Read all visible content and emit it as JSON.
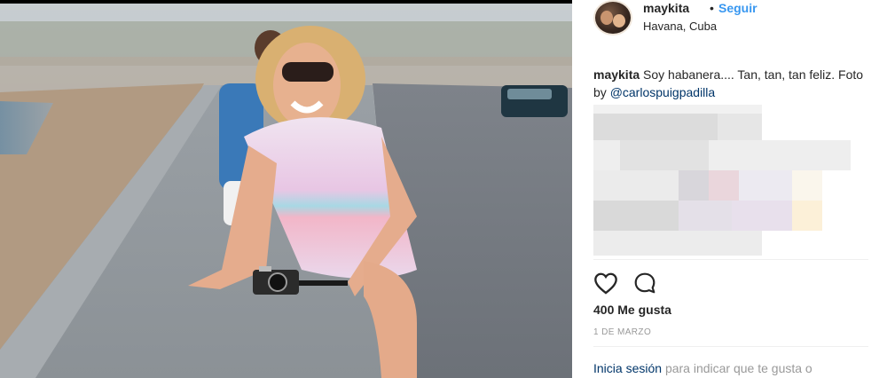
{
  "post": {
    "username": "maykita",
    "separator": "•",
    "follow_label": "Seguir",
    "location": "Havana, Cuba",
    "caption": {
      "username": "maykita",
      "text": "Soy habanera.... Tan, tan, tan feliz. Foto by ",
      "mention": "@carlospuigpadilla"
    },
    "likes": "400 Me gusta",
    "date": "1 DE MARZO",
    "login": {
      "link": "Inicia sesión",
      "rest": "para indicar que te gusta o"
    }
  },
  "icons": {
    "like": "heart-outline-icon",
    "comment": "comment-bubble-icon"
  },
  "colors": {
    "link_blue": "#3897f0",
    "mention_blue": "#003569",
    "muted": "#999999"
  }
}
